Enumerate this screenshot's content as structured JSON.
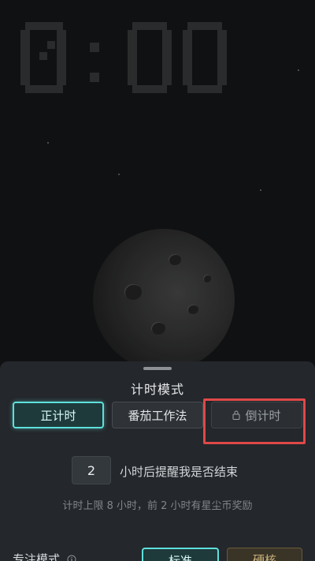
{
  "clock": {
    "display": "0:00"
  },
  "timer_sheet": {
    "title": "计时模式",
    "modes": [
      {
        "label": "正计时",
        "state": "selected"
      },
      {
        "label": "番茄工作法",
        "state": "normal"
      },
      {
        "label": "倒计时",
        "state": "locked"
      }
    ],
    "reminder": {
      "hours_value": "2",
      "label": "小时后提醒我是否结束"
    },
    "hint": "计时上限 8 小时，前 2 小时有星尘币奖励",
    "focus_mode": {
      "label": "专注模式",
      "options": [
        "标准",
        "硬核"
      ]
    }
  },
  "colors": {
    "accent": "#5ee0dc",
    "highlight_box": "#e04848",
    "sheet_bg": "#24272b"
  },
  "icons": {
    "lock": "lock-icon",
    "info": "info-icon"
  }
}
